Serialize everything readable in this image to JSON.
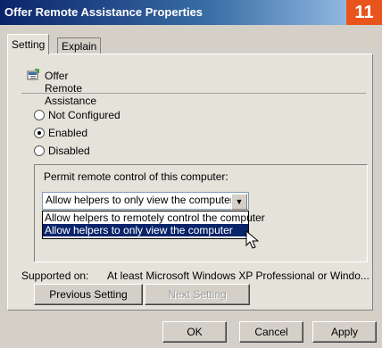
{
  "window": {
    "title": "Offer Remote Assistance Properties",
    "badge": "11"
  },
  "tabs": [
    {
      "label": "Setting"
    },
    {
      "label": "Explain"
    }
  ],
  "policy": {
    "name": "Offer Remote Assistance"
  },
  "options": {
    "not_configured": "Not Configured",
    "enabled": "Enabled",
    "disabled": "Disabled"
  },
  "group": {
    "label": "Permit remote control of this computer:",
    "selected_value": "Allow helpers to only view the computer",
    "dropdown_items": [
      "Allow helpers to remotely control the computer",
      "Allow helpers to only view the computer"
    ]
  },
  "supported": {
    "label": "Supported on:",
    "value": "At least Microsoft Windows XP Professional or Windo..."
  },
  "nav_buttons": {
    "previous": "Previous Setting",
    "next": "Next Setting"
  },
  "footer_buttons": {
    "ok": "OK",
    "cancel": "Cancel",
    "apply": "Apply"
  }
}
